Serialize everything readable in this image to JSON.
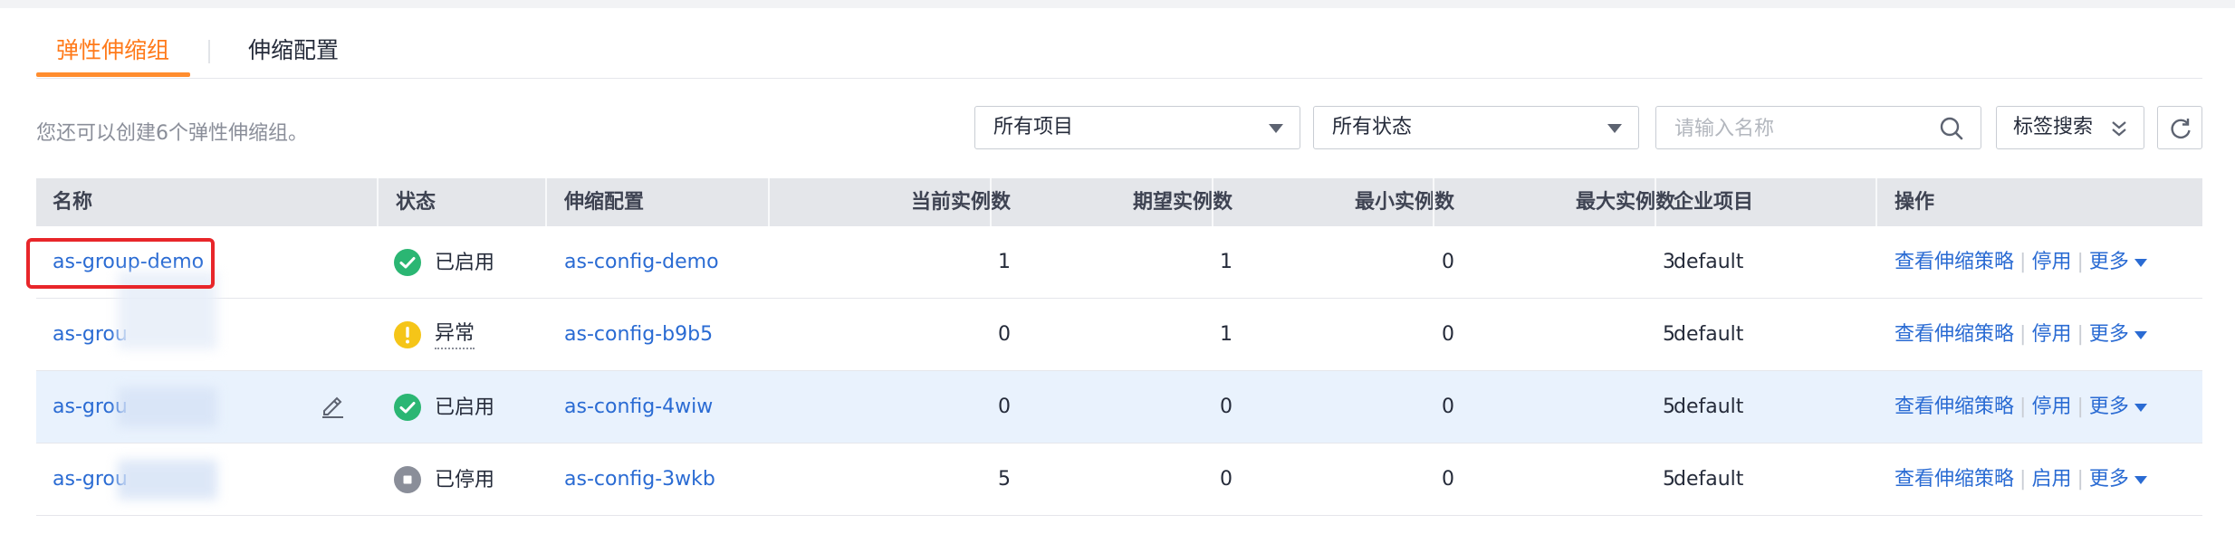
{
  "tabs": [
    {
      "label": "弹性伸缩组",
      "active": true
    },
    {
      "label": "伸缩配置",
      "active": false
    }
  ],
  "toolbar": {
    "quota_text": "您还可以创建6个弹性伸缩组。",
    "project_select": "所有项目",
    "status_select": "所有状态",
    "search_placeholder": "请输入名称",
    "tag_search_label": "标签搜索"
  },
  "table": {
    "columns": [
      "名称",
      "状态",
      "伸缩配置",
      "当前实例数",
      "期望实例数",
      "最小实例数",
      "最大实例数",
      "企业项目",
      "操作"
    ],
    "rows": [
      {
        "name": "as-group-demo",
        "status": "已启用",
        "status_kind": "enabled",
        "config": "as-config-demo",
        "current": "1",
        "desired": "1",
        "min": "0",
        "max": "3",
        "project": "default",
        "op1": "查看伸缩策略",
        "op2": "停用",
        "op3": "更多"
      },
      {
        "name": "as-grou",
        "status": "异常",
        "status_kind": "error",
        "config": "as-config-b9b5",
        "current": "0",
        "desired": "1",
        "min": "0",
        "max": "5",
        "project": "default",
        "op1": "查看伸缩策略",
        "op2": "停用",
        "op3": "更多"
      },
      {
        "name": "as-grou",
        "status": "已启用",
        "status_kind": "enabled",
        "config": "as-config-4wiw",
        "current": "0",
        "desired": "0",
        "min": "0",
        "max": "5",
        "project": "default",
        "op1": "查看伸缩策略",
        "op2": "停用",
        "op3": "更多"
      },
      {
        "name": "as-grou",
        "status": "已停用",
        "status_kind": "stopped",
        "config": "as-config-3wkb",
        "current": "5",
        "desired": "0",
        "min": "0",
        "max": "5",
        "project": "default",
        "op1": "查看伸缩策略",
        "op2": "启用",
        "op3": "更多"
      }
    ]
  },
  "colors": {
    "accent": "#ff8d2f",
    "link": "#2a6bd3",
    "status_enabled": "#2bb673",
    "status_error": "#f5c518",
    "status_stopped": "#8a8e99",
    "highlight_box": "#e8262a"
  },
  "icons": [
    "search-icon",
    "double-chevron-down-icon",
    "refresh-icon",
    "check-circle-icon",
    "warning-circle-icon",
    "stop-circle-icon",
    "edit-icon",
    "caret-down-icon"
  ]
}
